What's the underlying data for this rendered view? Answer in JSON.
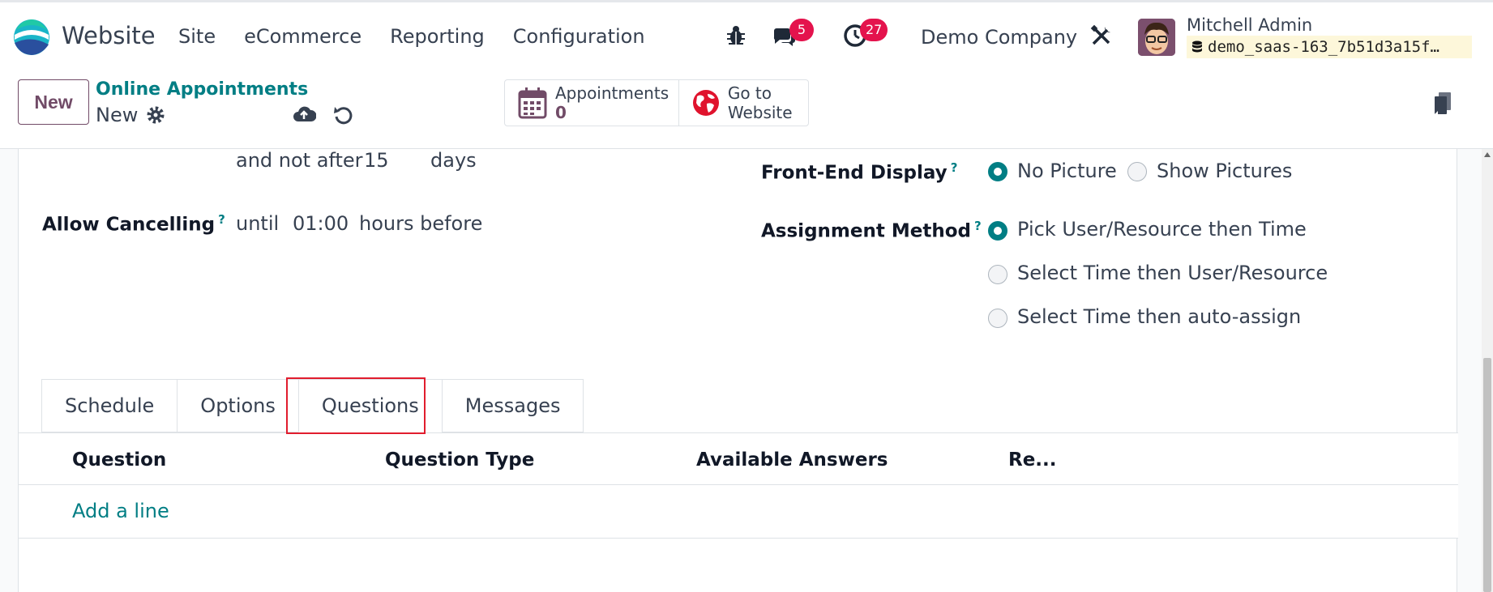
{
  "navbar": {
    "app_name": "Website",
    "menu": [
      "Site",
      "eCommerce",
      "Reporting",
      "Configuration"
    ],
    "messages_count": "5",
    "activities_count": "27",
    "company": "Demo Company",
    "user_name": "Mitchell Admin",
    "database": "demo_saas-163_7b51d3a15f…"
  },
  "control": {
    "new_label": "New",
    "breadcrumb": "Online Appointments",
    "record_name": "New",
    "stat_appointments_label": "Appointments",
    "stat_appointments_value": "0",
    "stat_website_line1": "Go to",
    "stat_website_line2": "Website"
  },
  "form": {
    "not_after_text": "and not after",
    "not_after_value": "15",
    "not_after_unit": "days",
    "allow_cancelling_label": "Allow Cancelling",
    "help_mark": "?",
    "until_text": "until",
    "until_value": "01:00",
    "hours_before": "hours before",
    "front_end_label": "Front-End Display",
    "front_end_options": [
      "No Picture",
      "Show Pictures"
    ],
    "assignment_label": "Assignment Method",
    "assignment_options": [
      "Pick User/Resource then Time",
      "Select Time then User/Resource",
      "Select Time then auto-assign"
    ]
  },
  "tabs": [
    "Schedule",
    "Options",
    "Questions",
    "Messages"
  ],
  "questions_table": {
    "columns": [
      "Question",
      "Question Type",
      "Available Answers",
      "Re..."
    ],
    "add_line": "Add a line"
  },
  "colors": {
    "primary": "#714b67",
    "accent": "#017e84",
    "badge": "#e4134d",
    "highlight": "#e11d2e"
  }
}
